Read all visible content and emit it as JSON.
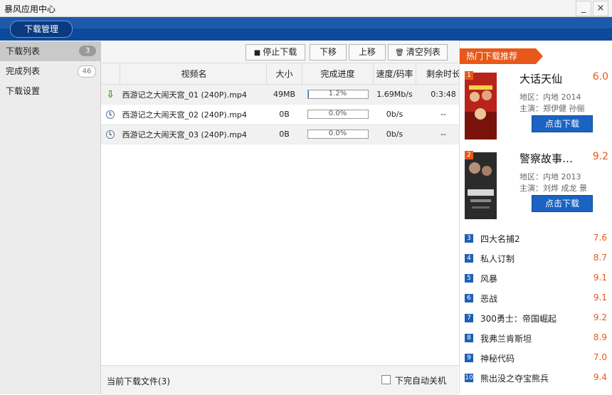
{
  "window": {
    "title": "暴风应用中心",
    "minimize": "_",
    "close": "×"
  },
  "header": {
    "tab": "下载管理"
  },
  "sidebar": {
    "items": [
      {
        "label": "下载列表",
        "badge": "3"
      },
      {
        "label": "完成列表",
        "badge": "46"
      },
      {
        "label": "下载设置",
        "badge": ""
      }
    ]
  },
  "toolbar": {
    "stop": "停止下载",
    "move_down": "下移",
    "move_up": "上移",
    "clear": "清空列表"
  },
  "table": {
    "headers": [
      "视频名",
      "大小",
      "完成进度",
      "速度/码率",
      "剩余时长"
    ],
    "rows": [
      {
        "status": "downloading",
        "name": "西游记之大闹天宫_01 (240P).mp4",
        "size": "49MB",
        "progress": "1.2%",
        "progress_value": 1.2,
        "speed": "1.69Mb/s",
        "remaining": "0:3:48"
      },
      {
        "status": "waiting",
        "name": "西游记之大闹天宫_02 (240P).mp4",
        "size": "0B",
        "progress": "0.0%",
        "progress_value": 0,
        "speed": "0b/s",
        "remaining": "--"
      },
      {
        "status": "waiting",
        "name": "西游记之大闹天宫_03 (240P).mp4",
        "size": "0B",
        "progress": "0.0%",
        "progress_value": 0,
        "speed": "0b/s",
        "remaining": "--"
      }
    ]
  },
  "footer": {
    "current_files": "当前下载文件(3)",
    "auto_shutdown": "下完自动关机"
  },
  "hot": {
    "title": "热门下载推荐",
    "featured": [
      {
        "rank": "1",
        "title": "大话天仙",
        "score": "6.0",
        "region": "地区：内地  2014",
        "cast": "主演：郑伊健   孙俪",
        "button": "点击下载"
      },
      {
        "rank": "2",
        "title": "警察故事…",
        "score": "9.2",
        "region": "地区：内地  2013",
        "cast": "主演：刘烨   成龙   景",
        "button": "点击下载"
      }
    ],
    "list": [
      {
        "rank": "3",
        "title": "四大名捕2",
        "score": "7.6"
      },
      {
        "rank": "4",
        "title": "私人订制",
        "score": "8.7"
      },
      {
        "rank": "5",
        "title": "风暴",
        "score": "9.1"
      },
      {
        "rank": "6",
        "title": "恶战",
        "score": "9.1"
      },
      {
        "rank": "7",
        "title": "300勇士：帝国崛起",
        "score": "9.2"
      },
      {
        "rank": "8",
        "title": "我弗兰肯斯坦",
        "score": "8.9"
      },
      {
        "rank": "9",
        "title": "神秘代码",
        "score": "7.0"
      },
      {
        "rank": "10",
        "title": "熊出没之夺宝熊兵",
        "score": "9.4"
      }
    ]
  }
}
